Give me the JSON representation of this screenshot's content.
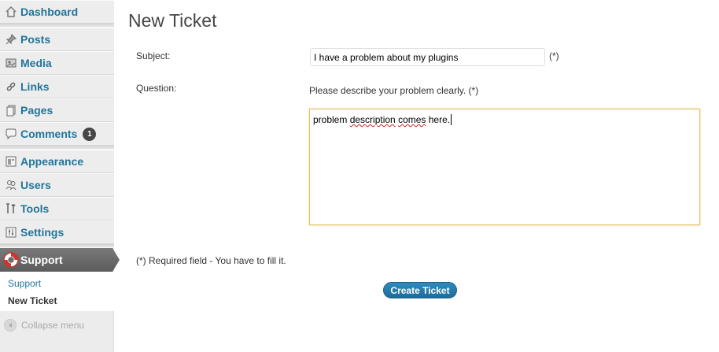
{
  "sidebar": {
    "items": [
      {
        "label": "Dashboard",
        "icon": "house-icon"
      },
      {
        "label": "Posts",
        "icon": "pushpin-icon"
      },
      {
        "label": "Media",
        "icon": "media-icon"
      },
      {
        "label": "Links",
        "icon": "link-icon"
      },
      {
        "label": "Pages",
        "icon": "pages-icon"
      },
      {
        "label": "Comments",
        "icon": "speech-bubble-icon",
        "badge": "1"
      },
      {
        "label": "Appearance",
        "icon": "appearance-icon"
      },
      {
        "label": "Users",
        "icon": "users-icon"
      },
      {
        "label": "Tools",
        "icon": "tools-icon"
      },
      {
        "label": "Settings",
        "icon": "settings-icon"
      }
    ],
    "active": {
      "label": "Support",
      "icon": "lifebuoy-icon"
    },
    "submenu": [
      "Support",
      "New Ticket"
    ],
    "collapse_label": "Collapse menu"
  },
  "main": {
    "title": "New Ticket",
    "subject_label": "Subject:",
    "subject_value": "I have a problem about my plugins",
    "required_mark": "(*)",
    "question_label": "Question:",
    "question_hint": "Please describe your problem clearly. (*)",
    "question_value_parts": [
      "problem ",
      "description",
      " ",
      "comes",
      " here."
    ],
    "required_note": "(*) Required field - You have to fill it.",
    "submit_label": "Create Ticket"
  },
  "colors": {
    "link": "#21759b",
    "active_bg": "#6d6d6d",
    "button": "#2e8bbf",
    "focus_border": "#e6c36a"
  }
}
